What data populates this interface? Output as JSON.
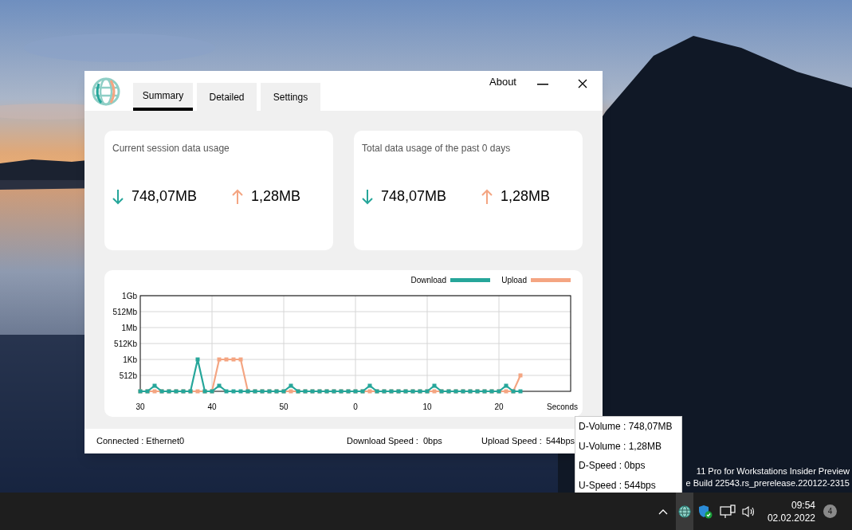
{
  "desktop": {
    "build_info": [
      "11 Pro for Workstations Insider Preview",
      "e Build 22543.rs_prerelease.220122-2315"
    ]
  },
  "window": {
    "tabs": [
      {
        "label": "Summary",
        "selected": true
      },
      {
        "label": "Detailed",
        "selected": false
      },
      {
        "label": "Settings",
        "selected": false
      }
    ],
    "about": "About",
    "cards": [
      {
        "title": "Current session data usage",
        "download": "748,07MB",
        "upload": "1,28MB"
      },
      {
        "title": "Total data usage of the past 0 days",
        "download": "748,07MB",
        "upload": "1,28MB"
      }
    ],
    "chart": {
      "legend": [
        {
          "name": "Download",
          "color": "#26a69a"
        },
        {
          "name": "Upload",
          "color": "#f4a582"
        }
      ],
      "y_labels": [
        "1Gb",
        "512Mb",
        "1Mb",
        "512Kb",
        "1Kb",
        "512b"
      ],
      "x_labels": [
        "30",
        "40",
        "50",
        "0",
        "10",
        "20"
      ],
      "x_title": "Seconds"
    },
    "status_bar": {
      "connection": "Connected : Ethernet0",
      "download_label": "Download Speed :",
      "download_value": "0bps",
      "upload_label": "Upload Speed :",
      "upload_value": "544bps"
    }
  },
  "tooltip": [
    "D-Volume : 748,07MB",
    "U-Volume : 1,28MB",
    "D-Speed : 0bps",
    "U-Speed : 544bps"
  ],
  "taskbar": {
    "time": "09:54",
    "date": "02.02.2022",
    "notification_count": "4"
  }
}
